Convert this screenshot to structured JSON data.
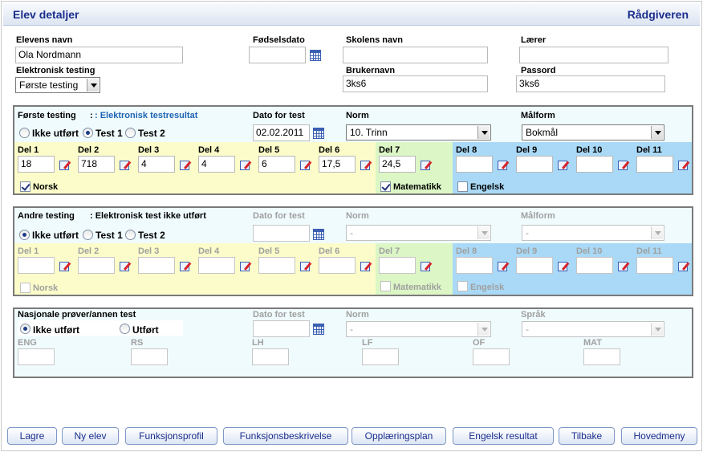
{
  "header": {
    "title": "Elev detaljer",
    "role": "Rådgiveren"
  },
  "student": {
    "name_label": "Elevens navn",
    "name_value": "Ola Nordmann",
    "birth_label": "Fødselsdato",
    "birth_value": "",
    "school_label": "Skolens navn",
    "school_value": "",
    "teacher_label": "Lærer",
    "teacher_value": "",
    "etesting_label": "Elektronisk testing",
    "etesting_value": "Første testing",
    "username_label": "Brukernavn",
    "username_value": "3ks6",
    "password_label": "Passord",
    "password_value": "3ks6"
  },
  "first_test": {
    "title": "Første testing",
    "status_text": ": Elektronisk testresultat",
    "radios": [
      "Ikke utført",
      "Test 1",
      "Test 2"
    ],
    "selected_radio": "Test 1",
    "date_label": "Dato for test",
    "date_value": "02.02.2011",
    "norm_label": "Norm",
    "norm_value": "10. Trinn",
    "malform_label": "Målform",
    "malform_value": "Bokmål",
    "parts": [
      {
        "label": "Del 1",
        "value": "18"
      },
      {
        "label": "Del 2",
        "value": "718"
      },
      {
        "label": "Del 3",
        "value": "4"
      },
      {
        "label": "Del 4",
        "value": "4"
      },
      {
        "label": "Del 5",
        "value": "6"
      },
      {
        "label": "Del 6",
        "value": "17,5"
      },
      {
        "label": "Del 7",
        "value": "24,5"
      },
      {
        "label": "Del 8",
        "value": ""
      },
      {
        "label": "Del 9",
        "value": ""
      },
      {
        "label": "Del 10",
        "value": ""
      },
      {
        "label": "Del 11",
        "value": ""
      }
    ],
    "checks": [
      {
        "label": "Norsk",
        "checked": true
      },
      {
        "label": "Matematikk",
        "checked": true
      },
      {
        "label": "Engelsk",
        "checked": false
      }
    ]
  },
  "second_test": {
    "title": "Andre testing",
    "status_text": ": Elektronisk test ikke utført",
    "radios": [
      "Ikke utført",
      "Test 1",
      "Test 2"
    ],
    "selected_radio": "Ikke utført",
    "date_label": "Dato for test",
    "date_value": "",
    "norm_label": "Norm",
    "norm_value": "-",
    "malform_label": "Målform",
    "malform_value": "-",
    "parts": [
      {
        "label": "Del 1",
        "value": ""
      },
      {
        "label": "Del 2",
        "value": ""
      },
      {
        "label": "Del 3",
        "value": ""
      },
      {
        "label": "Del 4",
        "value": ""
      },
      {
        "label": "Del 5",
        "value": ""
      },
      {
        "label": "Del 6",
        "value": ""
      },
      {
        "label": "Del 7",
        "value": ""
      },
      {
        "label": "Del 8",
        "value": ""
      },
      {
        "label": "Del 9",
        "value": ""
      },
      {
        "label": "Del 10",
        "value": ""
      },
      {
        "label": "Del 11",
        "value": ""
      }
    ],
    "checks": [
      {
        "label": "Norsk",
        "checked": false
      },
      {
        "label": "Matematikk",
        "checked": false
      },
      {
        "label": "Engelsk",
        "checked": false
      }
    ]
  },
  "national": {
    "title": "Nasjonale prøver/annen test",
    "radios": [
      "Ikke utført",
      "Utført"
    ],
    "selected_radio": "Ikke utført",
    "date_label": "Dato for test",
    "norm_label": "Norm",
    "norm_value": "-",
    "language_label": "Språk",
    "language_value": "-",
    "fields": [
      "ENG",
      "RS",
      "LH",
      "LF",
      "OF",
      "MAT"
    ]
  },
  "buttons": [
    "Lagre",
    "Ny elev",
    "Funksjonsprofil",
    "Funksjonsbeskrivelse",
    "Opplæringsplan",
    "Engelsk resultat",
    "Tilbake",
    "Hovedmeny"
  ],
  "colors": {
    "title": "#1a2e8c",
    "section_bg": "#f0fbfd",
    "band_norsk": "#fbfcc9",
    "band_matematikk": "#dcf6c5",
    "band_engelsk": "#a9d9f6"
  }
}
